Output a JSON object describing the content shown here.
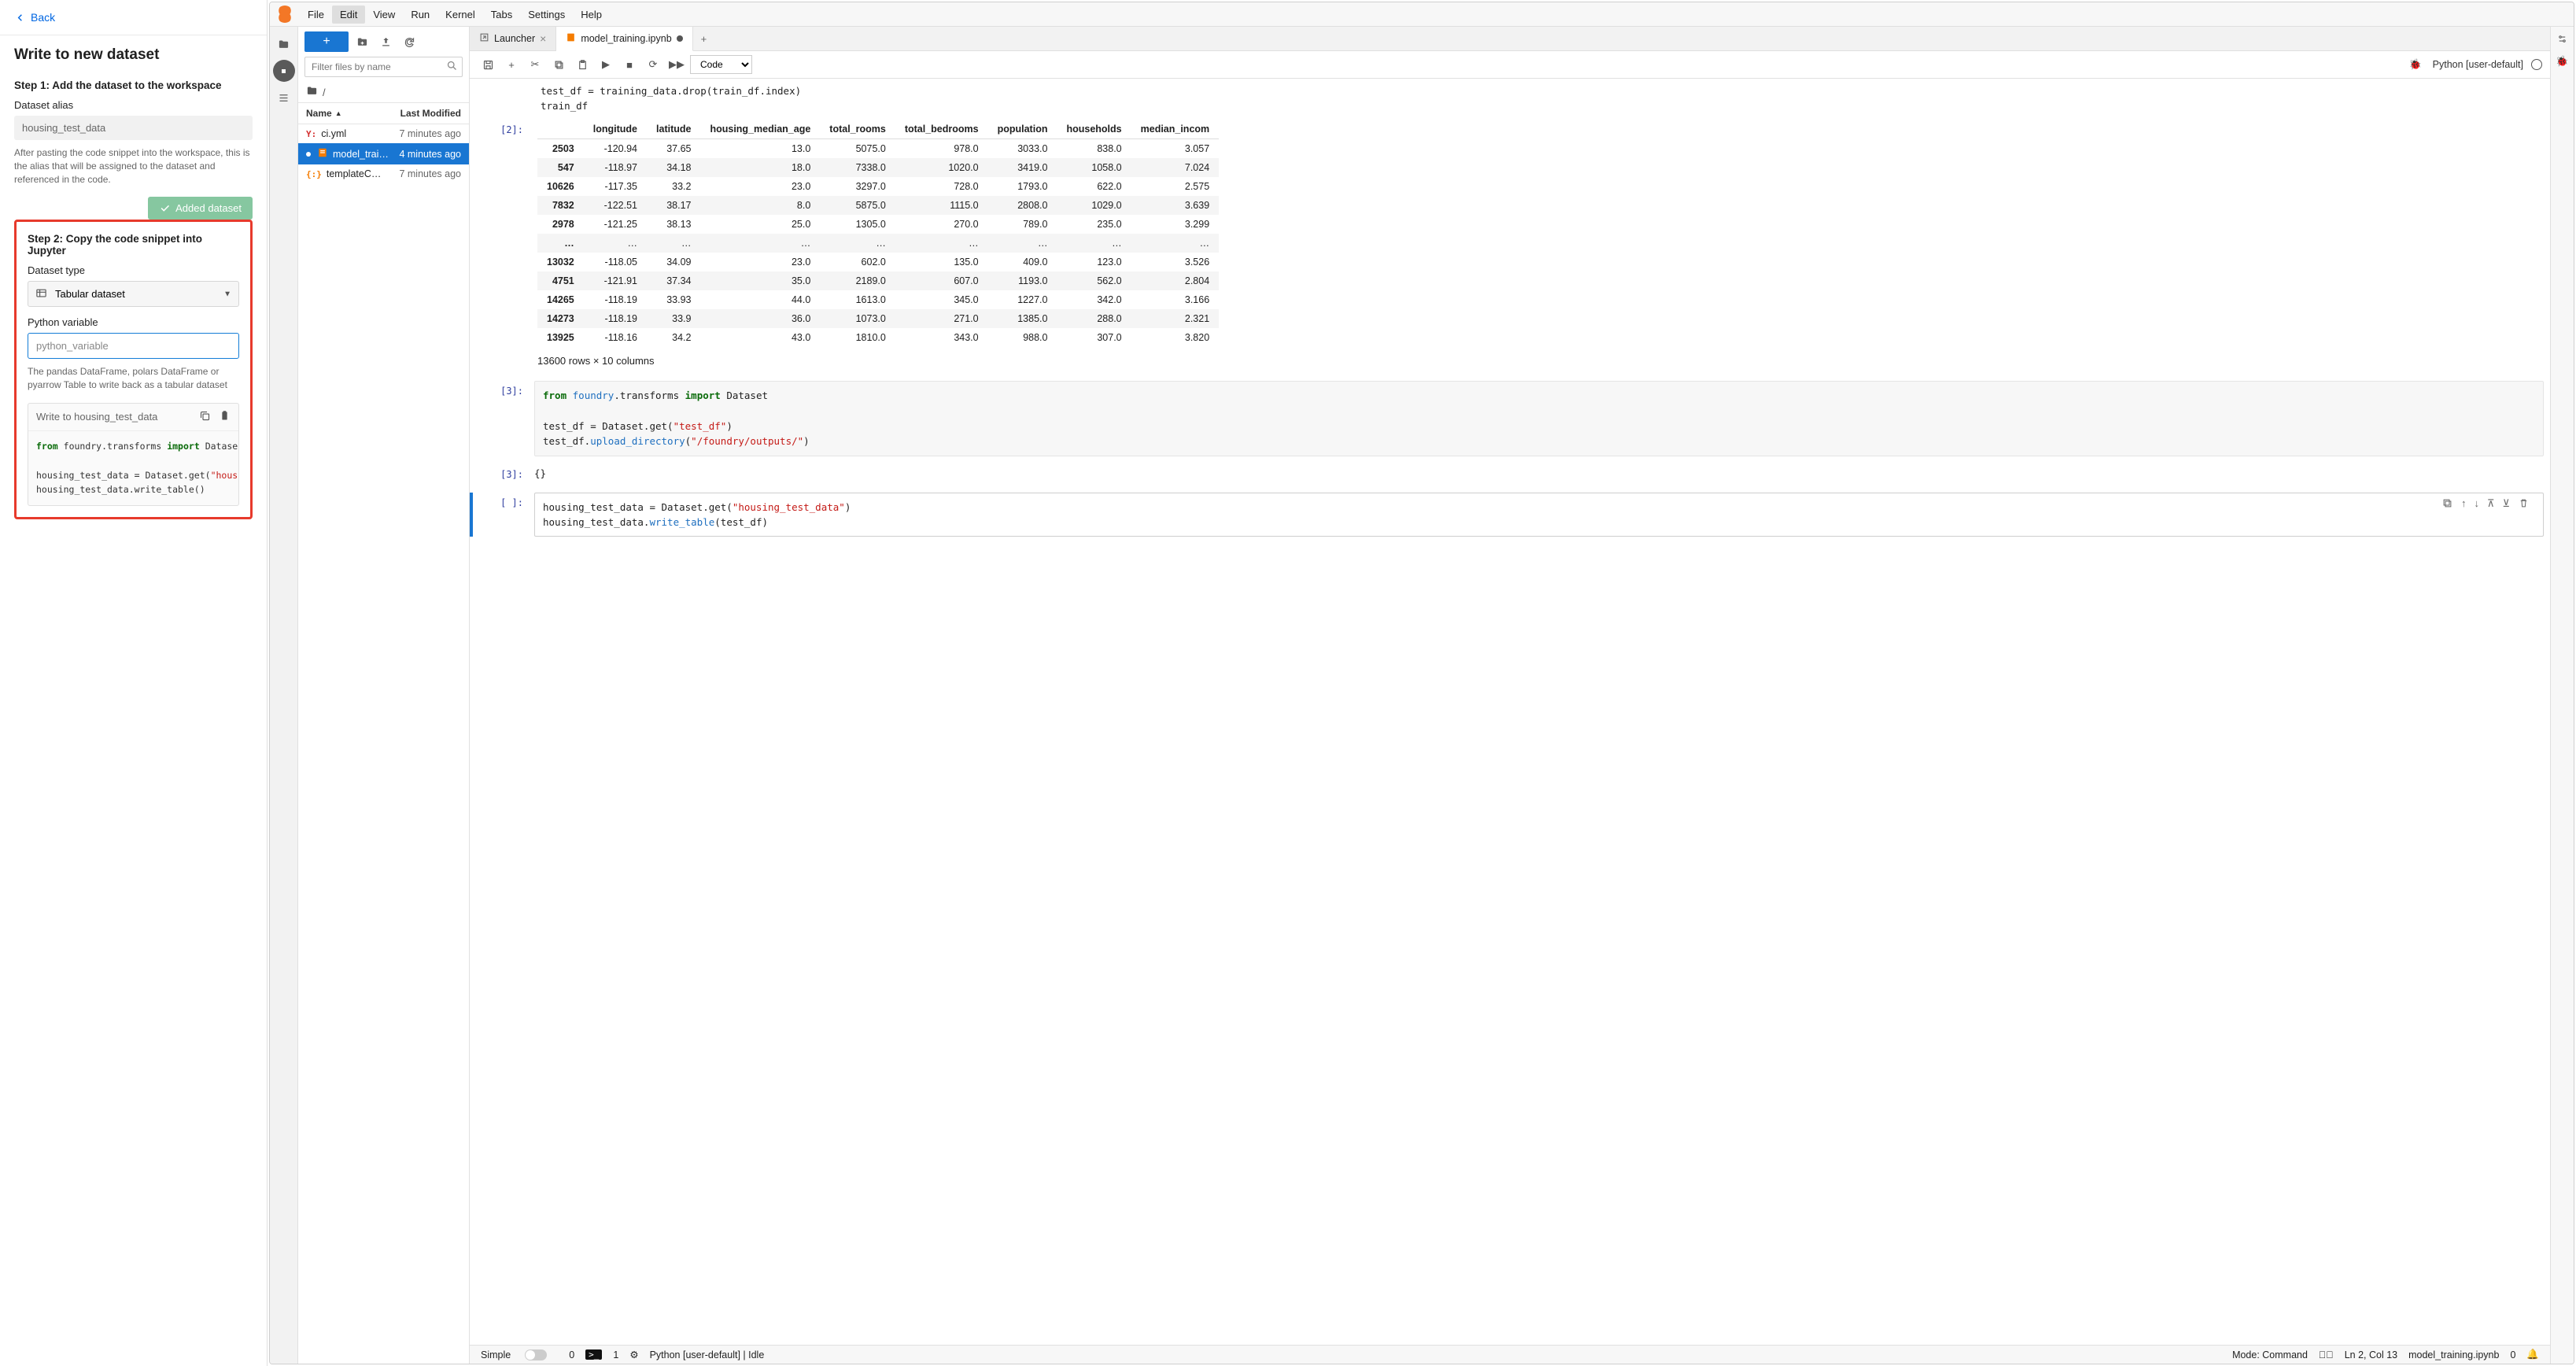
{
  "left": {
    "back": "Back",
    "title": "Write to new dataset",
    "step1": {
      "heading": "Step 1: Add the dataset to the workspace",
      "alias_label": "Dataset alias",
      "alias_value": "housing_test_data",
      "help": "After pasting the code snippet into the workspace, this is the alias that will be assigned to the dataset and referenced in the code.",
      "added_btn": "Added dataset"
    },
    "step2": {
      "heading": "Step 2: Copy the code snippet into Jupyter",
      "type_label": "Dataset type",
      "type_value": "Tabular dataset",
      "var_label": "Python variable",
      "var_placeholder": "python_variable",
      "var_help": "The pandas DataFrame, polars DataFrame or pyarrow Table to write back as a tabular dataset",
      "snippet_title": "Write to housing_test_data",
      "code_from": "from",
      "code_mod": "foundry.transforms",
      "code_import": "import",
      "code_cls": "Dataset",
      "code_l2a": "housing_test_data = Dataset.get(",
      "code_l2s": "\"housing_test_data\"",
      "code_l2b": ")",
      "code_l3": "housing_test_data.write_table()"
    }
  },
  "menubar": [
    "File",
    "Edit",
    "View",
    "Run",
    "Kernel",
    "Tabs",
    "Settings",
    "Help"
  ],
  "filebrowser": {
    "filter_placeholder": "Filter files by name",
    "breadcrumb": "/",
    "col_name": "Name",
    "col_modified": "Last Modified",
    "files": [
      {
        "icon": "yaml",
        "name": "ci.yml",
        "time": "7 minutes ago",
        "selected": false
      },
      {
        "icon": "notebook",
        "name": "model_trai…",
        "time": "4 minutes ago",
        "selected": true,
        "unsaved": true
      },
      {
        "icon": "json",
        "name": "templateC…",
        "time": "7 minutes ago",
        "selected": false
      }
    ]
  },
  "tabs": [
    {
      "icon": "launcher",
      "label": "Launcher",
      "active": false,
      "close": "x"
    },
    {
      "icon": "notebook",
      "label": "model_training.ipynb",
      "active": true,
      "close": "dot"
    }
  ],
  "toolbar": {
    "cell_type": "Code",
    "kernel": "Python [user-default]"
  },
  "notebook": {
    "pre_code_l1": "test_df = training_data.drop(train_df.index)",
    "pre_code_l2": "train_df",
    "in2_prompt": "[2]:",
    "df_columns": [
      "",
      "longitude",
      "latitude",
      "housing_median_age",
      "total_rooms",
      "total_bedrooms",
      "population",
      "households",
      "median_incom"
    ],
    "df_rows": [
      [
        "2503",
        "-120.94",
        "37.65",
        "13.0",
        "5075.0",
        "978.0",
        "3033.0",
        "838.0",
        "3.057"
      ],
      [
        "547",
        "-118.97",
        "34.18",
        "18.0",
        "7338.0",
        "1020.0",
        "3419.0",
        "1058.0",
        "7.024"
      ],
      [
        "10626",
        "-117.35",
        "33.2",
        "23.0",
        "3297.0",
        "728.0",
        "1793.0",
        "622.0",
        "2.575"
      ],
      [
        "7832",
        "-122.51",
        "38.17",
        "8.0",
        "5875.0",
        "1115.0",
        "2808.0",
        "1029.0",
        "3.639"
      ],
      [
        "2978",
        "-121.25",
        "38.13",
        "25.0",
        "1305.0",
        "270.0",
        "789.0",
        "235.0",
        "3.299"
      ],
      [
        "…",
        "…",
        "…",
        "…",
        "…",
        "…",
        "…",
        "…",
        "…"
      ],
      [
        "13032",
        "-118.05",
        "34.09",
        "23.0",
        "602.0",
        "135.0",
        "409.0",
        "123.0",
        "3.526"
      ],
      [
        "4751",
        "-121.91",
        "37.34",
        "35.0",
        "2189.0",
        "607.0",
        "1193.0",
        "562.0",
        "2.804"
      ],
      [
        "14265",
        "-118.19",
        "33.93",
        "44.0",
        "1613.0",
        "345.0",
        "1227.0",
        "342.0",
        "3.166"
      ],
      [
        "14273",
        "-118.19",
        "33.9",
        "36.0",
        "1073.0",
        "271.0",
        "1385.0",
        "288.0",
        "2.321"
      ],
      [
        "13925",
        "-118.16",
        "34.2",
        "43.0",
        "1810.0",
        "343.0",
        "988.0",
        "307.0",
        "3.820"
      ]
    ],
    "df_summary": "13600 rows × 10 columns",
    "in3_prompt": "[3]:",
    "cell3_l1_a": "from ",
    "cell3_l1_b": "foundry",
    "cell3_l1_c": ".transforms ",
    "cell3_l1_d": "import ",
    "cell3_l1_e": "Dataset",
    "cell3_l2_a": "test_df = Dataset.get(",
    "cell3_l2_s": "\"test_df\"",
    "cell3_l2_b": ")",
    "cell3_l3_a": "test_df.",
    "cell3_l3_b": "upload_directory",
    "cell3_l3_c": "(",
    "cell3_l3_s": "\"/foundry/outputs/\"",
    "cell3_l3_d": ")",
    "out3_prompt": "[3]:",
    "out3_val": "{}",
    "in4_prompt": "[ ]:",
    "cell4_l1_a": "housing_test_data = Dataset.get(",
    "cell4_l1_s": "\"housing_test_data\"",
    "cell4_l1_b": ")",
    "cell4_l2_a": "housing_test_data.",
    "cell4_l2_b": "write_table",
    "cell4_l2_c": "(test_df)"
  },
  "statusbar": {
    "simple": "Simple",
    "zero": "0",
    "one": "1",
    "kernel_status": "Python [user-default] | Idle",
    "mode": "Mode: Command",
    "ln": "Ln 2, Col 13",
    "file": "model_training.ipynb",
    "zero2": "0"
  }
}
